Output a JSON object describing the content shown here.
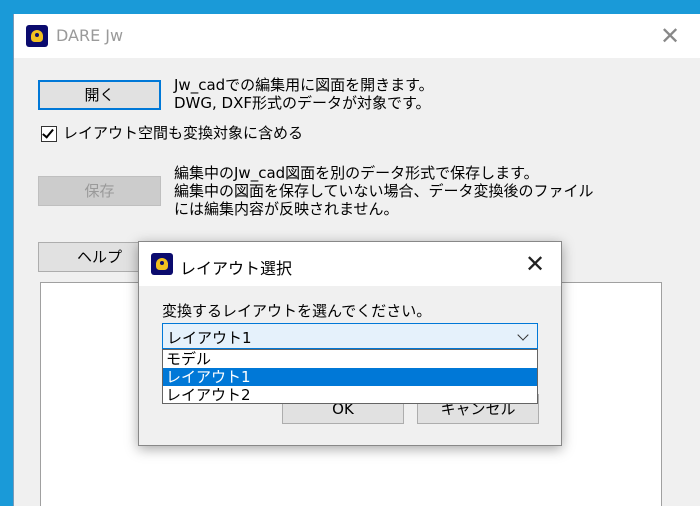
{
  "window": {
    "title": "DARE Jw",
    "close_glyph": "✕"
  },
  "open_section": {
    "button_label": "開く",
    "desc_line1": "Jw_cadでの編集用に図面を開きます。",
    "desc_line2": "DWG, DXF形式のデータが対象です。"
  },
  "layout_checkbox": {
    "label": "レイアウト空間も変換対象に含める",
    "checked": true
  },
  "save_section": {
    "button_label": "保存",
    "desc_line1": "編集中のJw_cad図面を別のデータ形式で保存します。",
    "desc_line2": "編集中の図面を保存していない場合、データ変換後のファイル",
    "desc_line3": "には編集内容が反映されません。"
  },
  "help_button": {
    "label": "ヘルプ"
  },
  "dialog": {
    "title": "レイアウト選択",
    "close_glyph": "✕",
    "prompt": "変換するレイアウトを選んでください。",
    "combo_value": "レイアウト1",
    "options": [
      "モデル",
      "レイアウト1",
      "レイアウト2"
    ],
    "selected_index": 1,
    "ok_label": "OK",
    "cancel_label": "キャンセル"
  },
  "colors": {
    "accent": "#0078d7",
    "desktop": "#1a9ad8"
  }
}
